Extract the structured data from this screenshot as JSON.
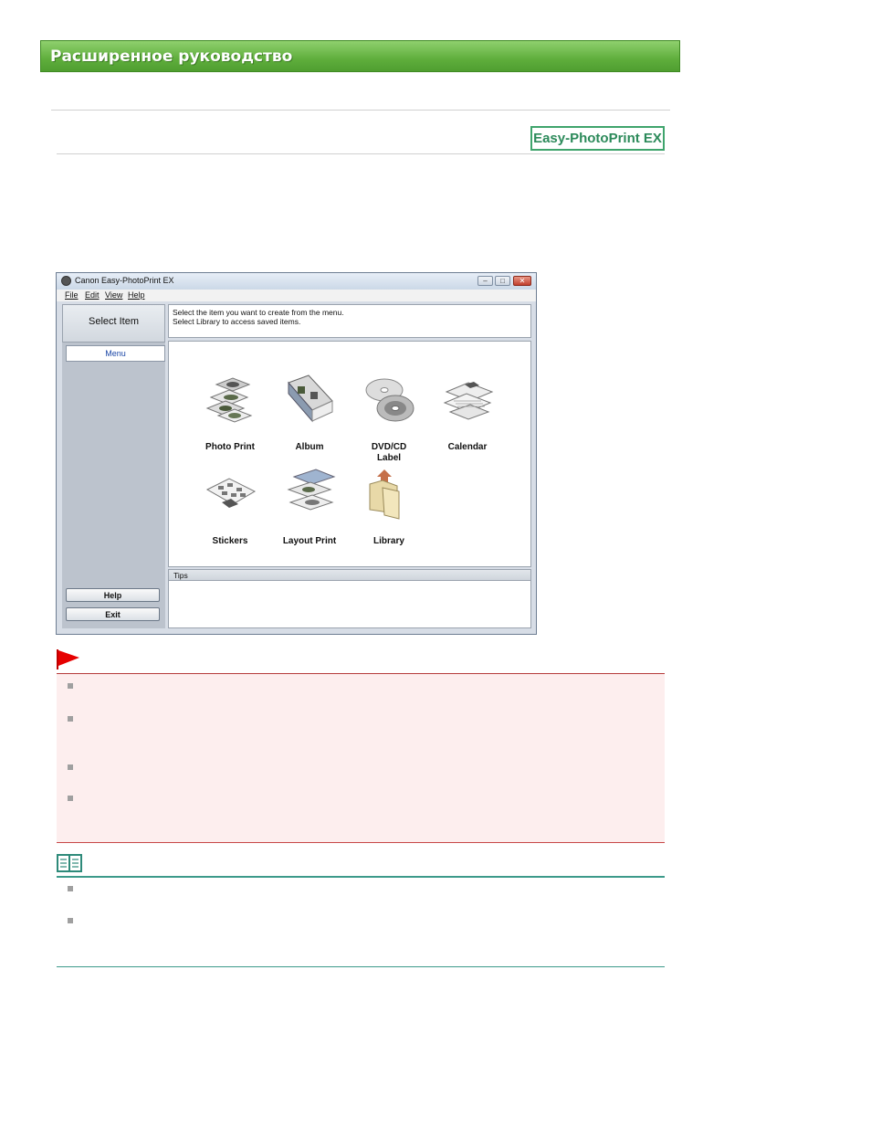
{
  "header": {
    "title": "Расширенное руководство"
  },
  "badge": {
    "label": "Easy-PhotoPrint EX"
  },
  "app_window": {
    "title": "Canon Easy-PhotoPrint EX",
    "menu": [
      "File",
      "Edit",
      "View",
      "Help"
    ],
    "sidebar": {
      "title": "Select Item",
      "tab": "Menu",
      "help_button": "Help",
      "exit_button": "Exit"
    },
    "message": {
      "line1": "Select the item you want to create from the menu.",
      "line2": "Select Library to access saved items."
    },
    "items": [
      {
        "label": "Photo Print",
        "icon": "photo-print-icon"
      },
      {
        "label": "Album",
        "icon": "album-icon"
      },
      {
        "label": "DVD/CD\nLabel",
        "icon": "disc-icon"
      },
      {
        "label": "Calendar",
        "icon": "calendar-icon"
      },
      {
        "label": "Stickers",
        "icon": "stickers-icon"
      },
      {
        "label": "Layout Print",
        "icon": "layout-print-icon"
      },
      {
        "label": "Library",
        "icon": "library-icon"
      }
    ],
    "tips_label": "Tips"
  },
  "colors": {
    "banner_green": "#5fae3c",
    "badge_green": "#2c8a5a",
    "important_bg": "#fdeeee",
    "important_line": "#b53a3a",
    "flag_red": "#e60000",
    "note_line": "#3c9a8a"
  }
}
